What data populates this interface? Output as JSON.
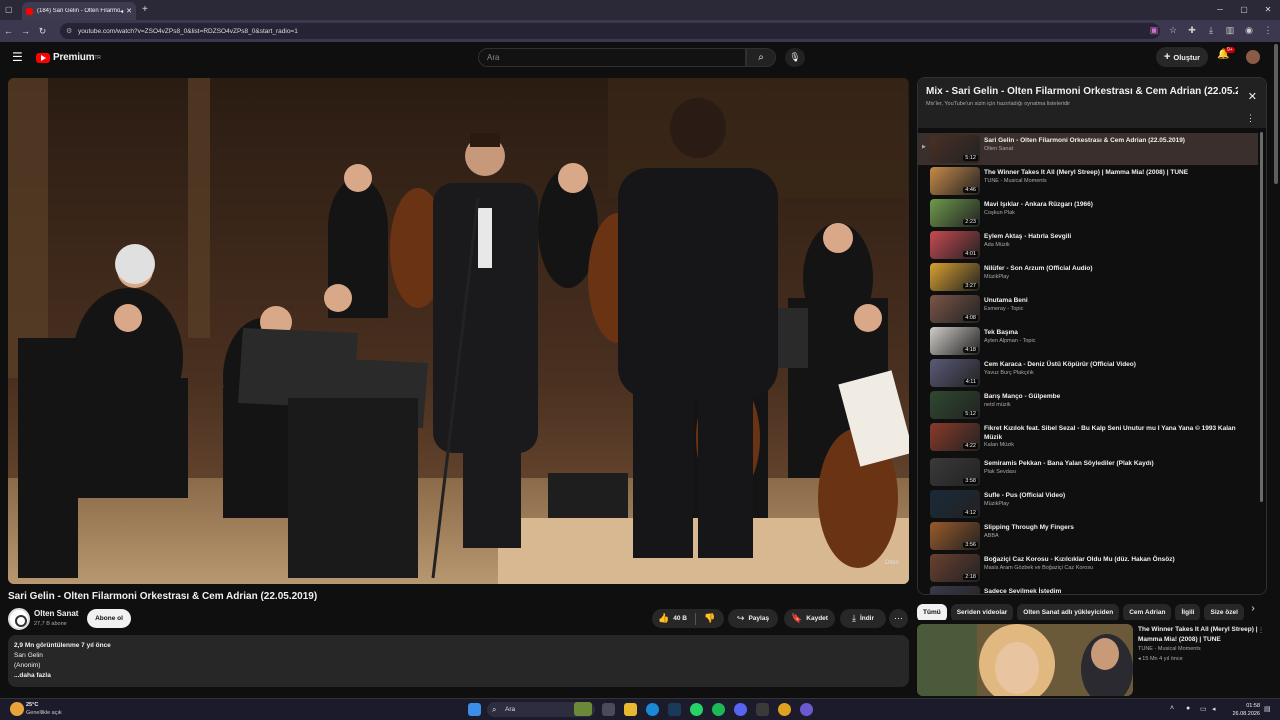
{
  "browser": {
    "tab_title": "(184) Sari Gelin - Olten Filarmoni Orkestrası & Cem Adrian (22.05.2019) - YouTube",
    "url": "youtube.com/watch?v=ZSO4vZPs8_0&list=RDZSO4vZPs8_0&start_radio=1"
  },
  "header": {
    "logo": "Premium",
    "logo_sup": "TR",
    "search_placeholder": "Ara",
    "create_label": "Oluştur",
    "notif_count": "9+"
  },
  "video": {
    "title": "Sari Gelin - Olten Filarmoni Orkestrası & Cem Adrian (22.05.2019)",
    "watermark": "Olten",
    "channel": "Olten Sanat",
    "subscribers": "27,7 B abone",
    "subscribe_label": "Abone ol",
    "likes": "40 B",
    "share_label": "Paylaş",
    "save_label": "Kaydet",
    "download_label": "İndir",
    "meta": "2,9 Mn görüntülenme  7 yıl önce",
    "desc_line1": "Sarı Gelin",
    "desc_line2": "(Anonim)",
    "more": "...daha fazla"
  },
  "playlist": {
    "title": "Mix - Sari Gelin - Olten Filarmoni Orkestrası & Cem Adrian (22.05.2019)",
    "subtitle": "Mix'ler, YouTube'un sizin için hazırladığı oynatma listeleridir",
    "items": [
      {
        "title": "Sari Gelin - Olten Filarmoni Orkestrası & Cem Adrian (22.05.2019)",
        "channel": "Olten Sanat",
        "duration": "5:12",
        "color": "#4a3025"
      },
      {
        "title": "The Winner Takes It All (Meryl Streep) | Mamma Mia! (2008) | TUNE",
        "channel": "TUNE - Musical Moments",
        "duration": "4:46",
        "color": "#c88a4a"
      },
      {
        "title": "Mavi Işıklar - Ankara Rüzgarı (1966)",
        "channel": "Coşkun Plak",
        "duration": "2:23",
        "color": "#6f9a4c"
      },
      {
        "title": "Eylem Aktaş - Hatırla Sevgili",
        "channel": "Ada Müzik",
        "duration": "4:01",
        "color": "#c74a52"
      },
      {
        "title": "Nilüfer - Son Arzum (Official Audio)",
        "channel": "MüzikPlay",
        "duration": "3:27",
        "color": "#d8a030"
      },
      {
        "title": "Unutama Beni",
        "channel": "Esmeray - Topic",
        "duration": "4:08",
        "color": "#7a5548"
      },
      {
        "title": "Tek Başına",
        "channel": "Ayten Alpman - Topic",
        "duration": "4:18",
        "color": "#d0ccc8"
      },
      {
        "title": "Cem Karaca - Deniz Üstü Köpürür (Official Video)",
        "channel": "Yavuz Burç Plakçılık",
        "duration": "4:11",
        "color": "#5a5a78"
      },
      {
        "title": "Barış Manço - Gülpembe",
        "channel": "netd müzik",
        "duration": "5:12",
        "color": "#2e4a30"
      },
      {
        "title": "Fikret Kızılok feat. Sibel Sezal - Bu Kalp Seni Unutur mu I Yana Yana © 1993 Kalan Müzik",
        "channel": "Kalan Müzik",
        "duration": "4:22",
        "color": "#8a3a2a"
      },
      {
        "title": "Semiramis Pekkan - Bana Yalan Söylediler (Plak Kaydı)",
        "channel": "Plak Sevdası",
        "duration": "3:58",
        "color": "#3a3a3a"
      },
      {
        "title": "Sufle - Pus (Official Video)",
        "channel": "MüzikPlay",
        "duration": "4:12",
        "color": "#1a2a3a"
      },
      {
        "title": "Slipping Through My Fingers",
        "channel": "ABBA",
        "duration": "3:56",
        "color": "#9a5a2a"
      },
      {
        "title": "Boğaziçi Caz Korosu - Kızılcıklar Oldu Mu (düz. Hakan Önsöz)",
        "channel": "Masis Aram Gözbek ve Boğaziçi Caz Korosu",
        "duration": "2:18",
        "color": "#6a4030"
      },
      {
        "title": "Sadece Sevilmek İstedim",
        "channel": "",
        "duration": "",
        "color": "#3a3a4a"
      }
    ]
  },
  "chips": [
    "Tümü",
    "Seriden videolar",
    "Olten Sanat adlı yükleyiciden",
    "Cem Adrian",
    "İlgili",
    "Size özel"
  ],
  "recommended": {
    "title": "The Winner Takes It All (Meryl Streep) | Mamma Mia! (2008) | TUNE",
    "channel": "TUNE - Musical Moments",
    "meta": "15 Mn  4 yıl önce"
  },
  "taskbar": {
    "temp": "25°C",
    "weather": "Genellikle açık",
    "search": "Ara",
    "time": "01:58",
    "date": "26.08.2026"
  }
}
